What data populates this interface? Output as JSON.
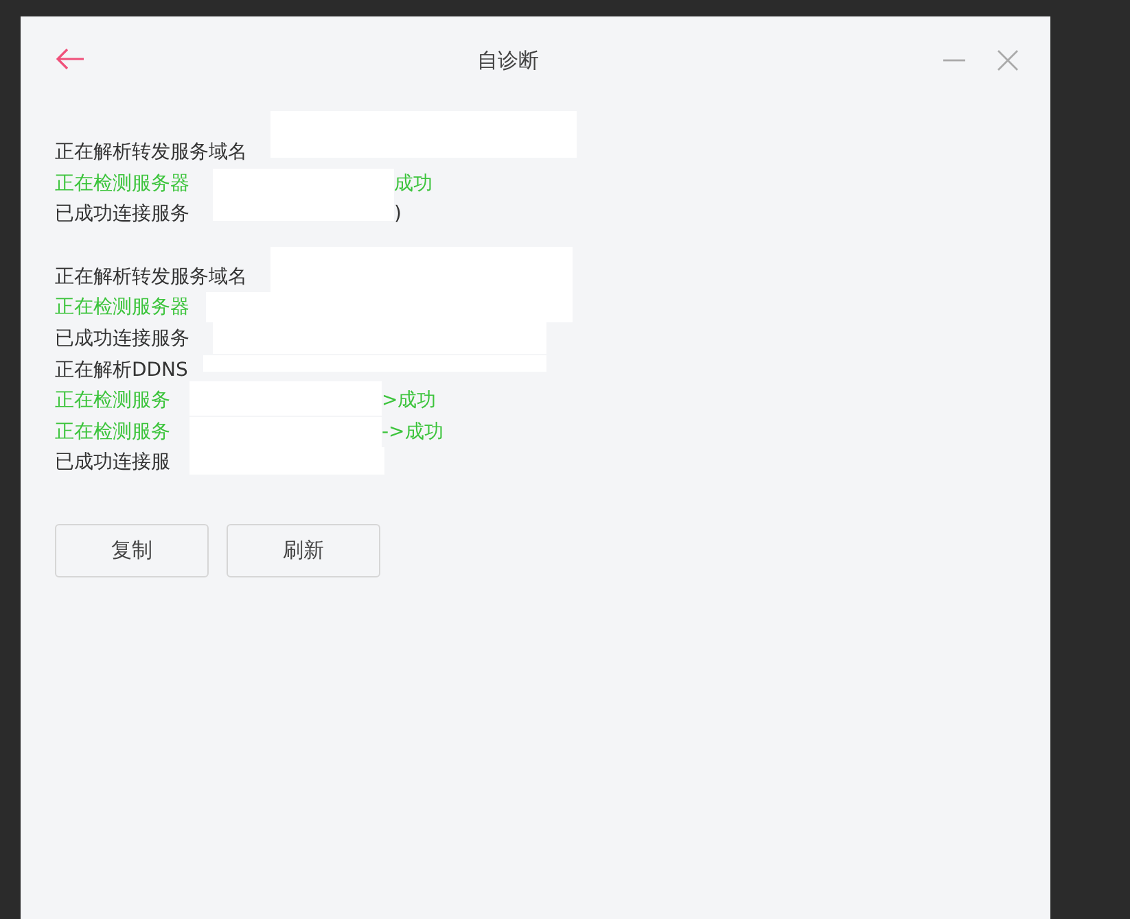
{
  "window": {
    "title": "自诊断"
  },
  "log_groups": [
    {
      "lines": [
        {
          "kind": "normal",
          "text": "正在解析转发服务域名"
        },
        {
          "kind": "success",
          "text": "正在检测服务器",
          "suffix": "成功"
        },
        {
          "kind": "normal",
          "text": "已成功连接服务",
          "suffix": ")"
        }
      ]
    },
    {
      "lines": [
        {
          "kind": "normal",
          "text": "正在解析转发服务域名"
        },
        {
          "kind": "success",
          "text": "正在检测服务器"
        },
        {
          "kind": "normal",
          "text": "已成功连接服务"
        },
        {
          "kind": "normal",
          "text": "正在解析DDNS"
        },
        {
          "kind": "success",
          "text": "正在检测服务",
          "suffix": ">成功"
        },
        {
          "kind": "success",
          "text": "正在检测服务",
          "suffix": "->成功"
        },
        {
          "kind": "normal",
          "text": "已成功连接服"
        }
      ]
    }
  ],
  "buttons": [
    "复制",
    "刷新"
  ]
}
